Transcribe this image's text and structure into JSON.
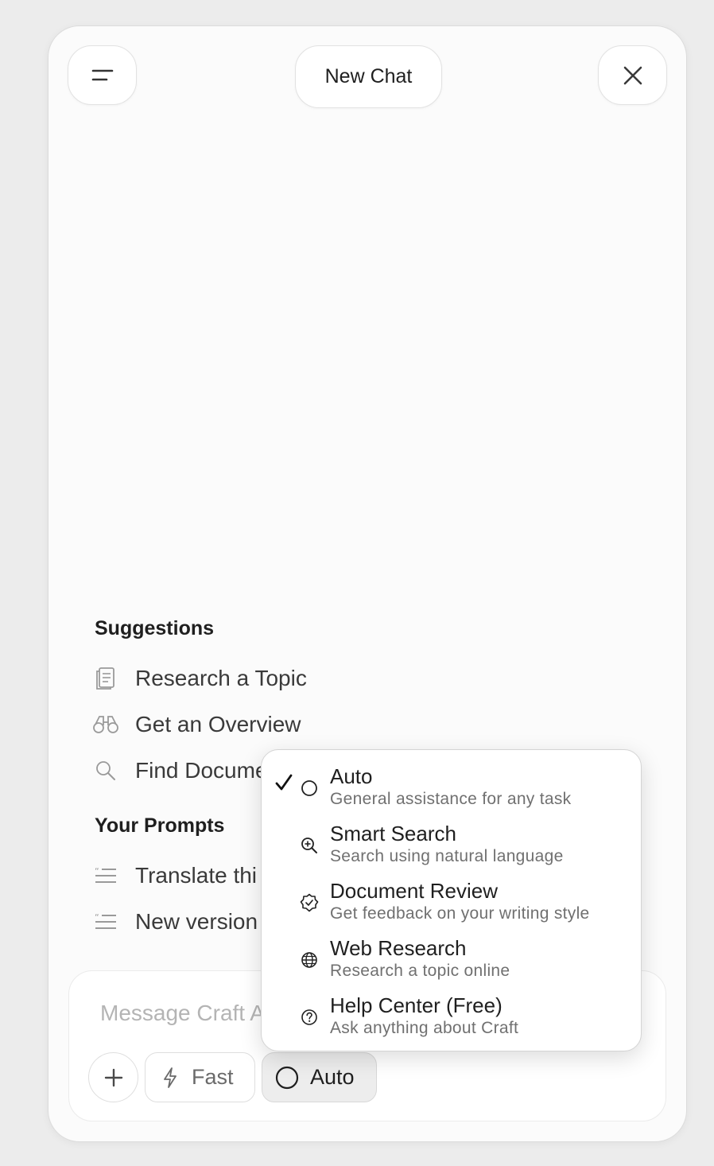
{
  "header": {
    "title": "New Chat",
    "menu_icon": "menu-lines-icon",
    "close_icon": "close-icon"
  },
  "suggestions": {
    "heading": "Suggestions",
    "items": [
      {
        "label": "Research a Topic",
        "icon": "document-icon"
      },
      {
        "label": "Get an Overview",
        "icon": "binoculars-icon"
      },
      {
        "label": "Find Docume",
        "icon": "search-icon"
      }
    ]
  },
  "prompts": {
    "heading": "Your Prompts",
    "items": [
      {
        "label": "Translate thi",
        "icon": "prompt-list-icon"
      },
      {
        "label": "New version",
        "icon": "prompt-list-icon"
      }
    ]
  },
  "composer": {
    "placeholder": "Message Craft A",
    "plus_icon": "plus-icon",
    "fast_label": "Fast",
    "fast_icon": "lightning-icon",
    "mode_label": "Auto",
    "mode_icon": "circle-icon"
  },
  "mode_menu": {
    "selected": "Auto",
    "options": [
      {
        "title": "Auto",
        "description": "General assistance for any task",
        "icon": "circle-icon",
        "checked": true
      },
      {
        "title": "Smart Search",
        "description": "Search using natural language",
        "icon": "zoom-search-icon",
        "checked": false
      },
      {
        "title": "Document Review",
        "description": "Get feedback on your writing style",
        "icon": "badge-check-icon",
        "checked": false
      },
      {
        "title": "Web Research",
        "description": "Research a topic online",
        "icon": "globe-icon",
        "checked": false
      },
      {
        "title": "Help Center (Free)",
        "description": "Ask anything about Craft",
        "icon": "help-circle-icon",
        "checked": false
      }
    ]
  }
}
